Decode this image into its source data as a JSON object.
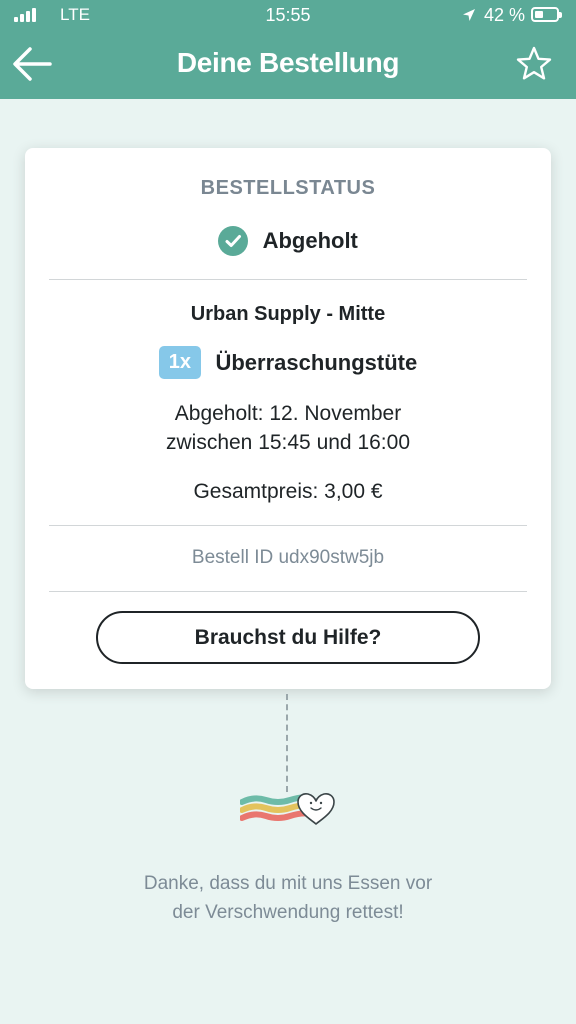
{
  "status_bar": {
    "network": "LTE",
    "time": "15:55",
    "battery": "42 %",
    "battery_level": 0.42,
    "icons": [
      "signal-icon",
      "location-arrow-icon",
      "battery-icon"
    ]
  },
  "header": {
    "title": "Deine Bestellung",
    "back_icon": "arrow-left-icon",
    "favorite_icon": "star-outline-icon"
  },
  "card": {
    "status_heading": "BESTELLSTATUS",
    "status_icon": "check-circle-icon",
    "status_value": "Abgeholt",
    "store_name": "Urban Supply - Mitte",
    "quantity": "1x",
    "item_name": "Überraschungstüte",
    "pickup_line1": "Abgeholt: 12. November",
    "pickup_line2": "zwischen 15:45 und 16:00",
    "total_price": "Gesamtpreis: 3,00 €",
    "order_id": "Bestell ID udx90stw5jb",
    "help_button": "Brauchst du Hilfe?"
  },
  "footer": {
    "logo_icon": "heart-rainbow-logo",
    "thanks_line1": "Danke, dass du mit uns Essen vor",
    "thanks_line2": "der Verschwendung rettest!"
  },
  "colors": {
    "primary": "#5aaa98",
    "background": "#e9f4f2",
    "badge": "#86c8e9",
    "text_dark": "#1f2427",
    "text_muted": "#7d8b96"
  }
}
